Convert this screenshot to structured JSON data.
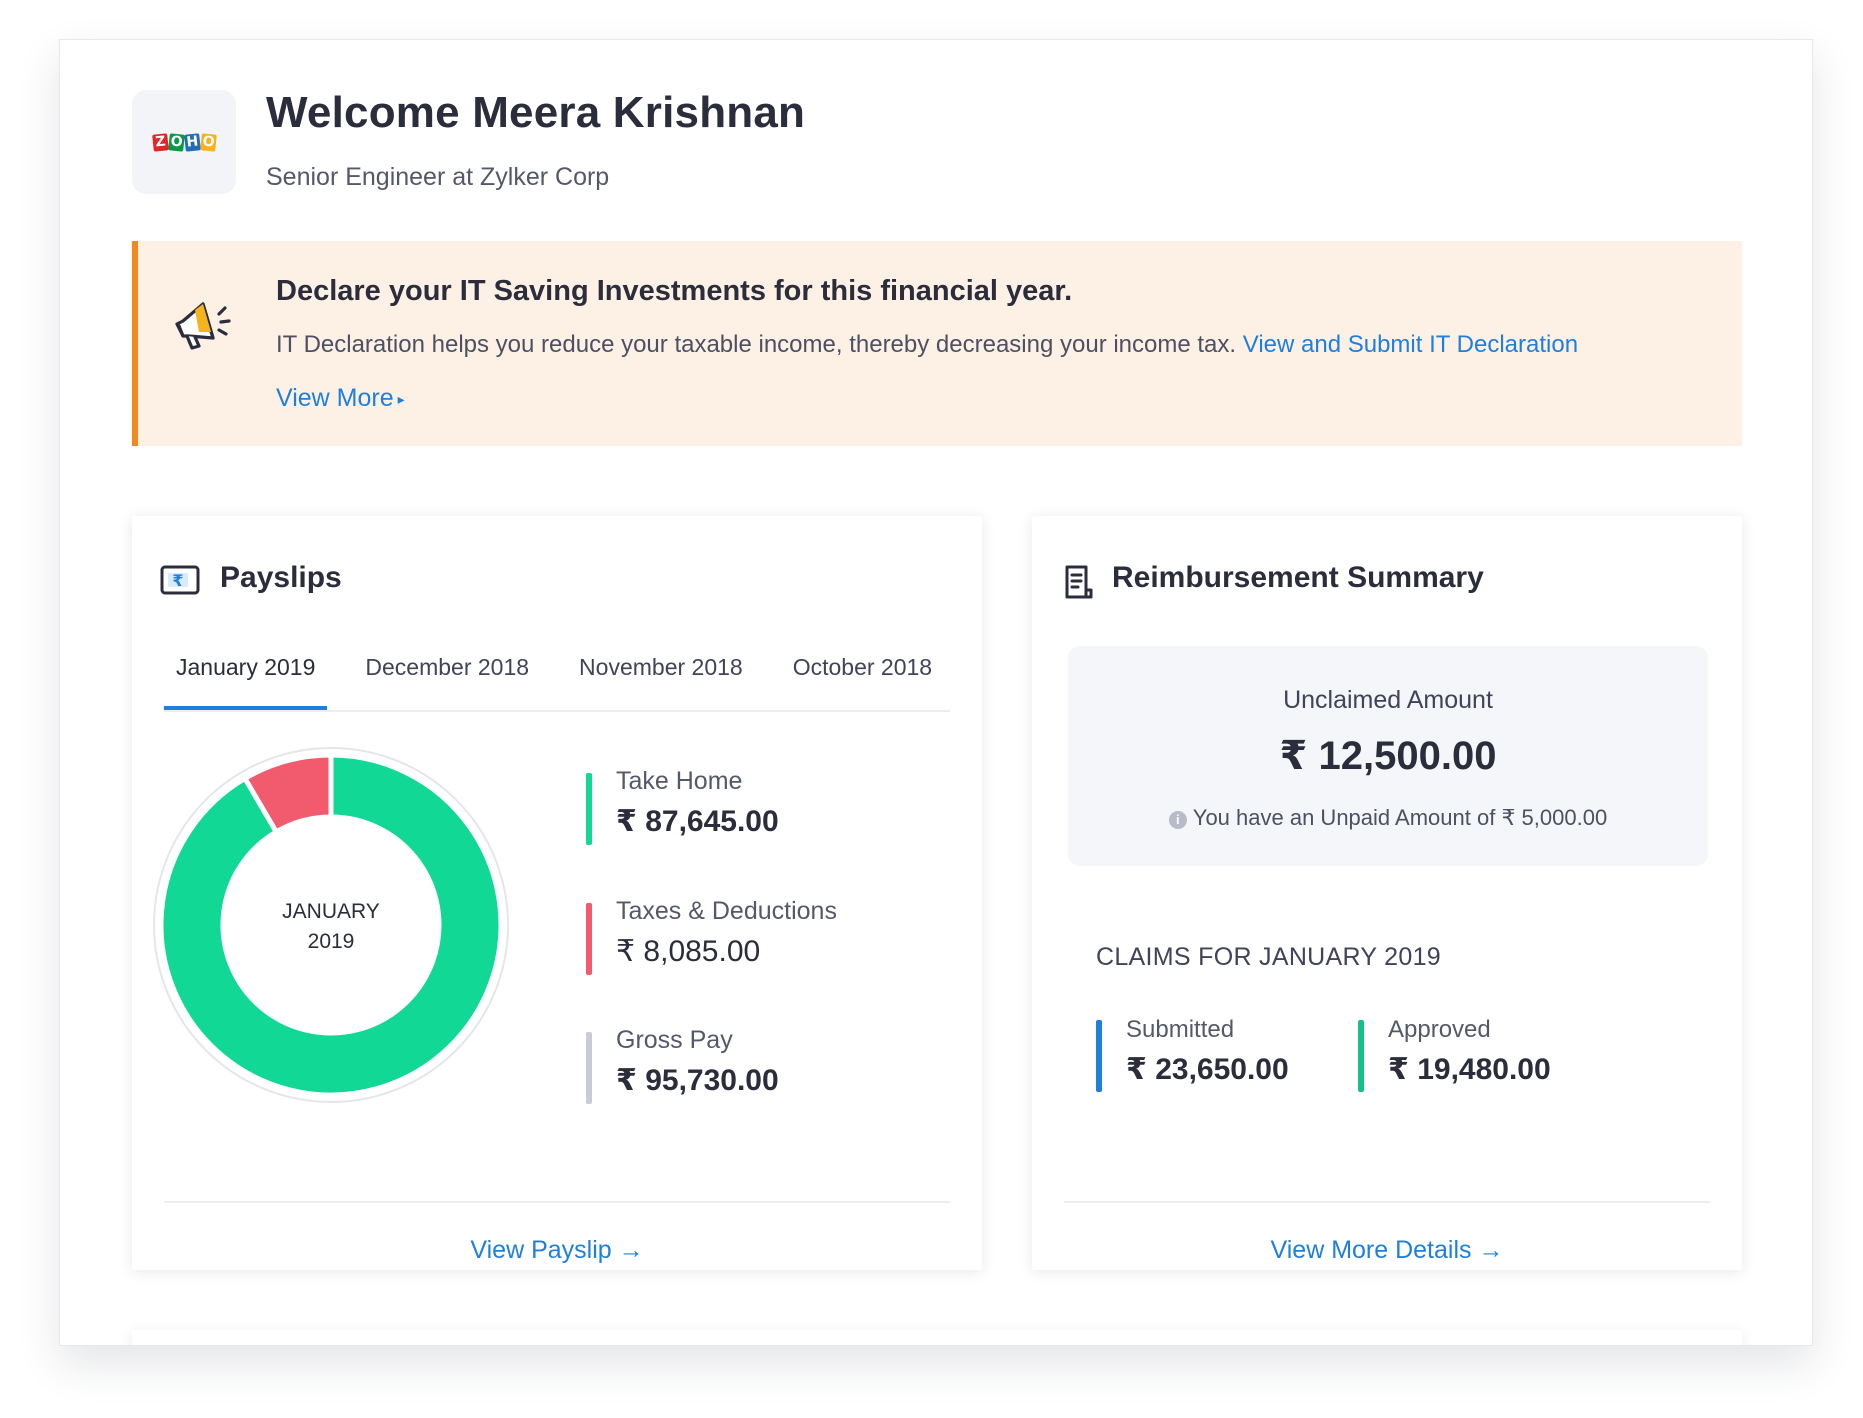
{
  "header": {
    "logo_letters": [
      "Z",
      "O",
      "H",
      "O"
    ],
    "logo_colors": [
      "#e42527",
      "#089949",
      "#226db4",
      "#f9b21d"
    ],
    "welcome": "Welcome Meera Krishnan",
    "subtitle": "Senior Engineer at Zylker Corp"
  },
  "banner": {
    "icon": "megaphone-icon",
    "title": "Declare your IT Saving Investments for this financial year.",
    "text": "IT Declaration helps you reduce your taxable income, thereby decreasing your income tax.",
    "link": "View and Submit IT Declaration",
    "more": "View More",
    "accent": "#f5871f"
  },
  "payslips": {
    "icon": "rupee-note-icon",
    "title": "Payslips",
    "tabs": [
      "January 2019",
      "December 2018",
      "November 2018",
      "October 2018"
    ],
    "active_tab": 0,
    "donut_center": [
      "JANUARY",
      "2019"
    ],
    "take_home": {
      "label": "Take Home",
      "value": "₹ 87,645.00",
      "color": "#12d895"
    },
    "deductions": {
      "label": "Taxes & Deductions",
      "value": "₹ 8,085.00",
      "color": "#f25a6e"
    },
    "gross": {
      "label": "Gross Pay",
      "value": "₹ 95,730.00",
      "color": "#c9ccd6"
    },
    "chart_data": {
      "type": "pie",
      "categories": [
        "Take Home",
        "Taxes & Deductions"
      ],
      "values": [
        87645,
        8085
      ],
      "colors": [
        "#12d895",
        "#f25a6e"
      ]
    },
    "footer_link": "View Payslip →"
  },
  "reimbursement": {
    "icon": "document-icon",
    "title": "Reimbursement Summary",
    "unclaimed_label": "Unclaimed Amount",
    "unclaimed_value": "₹ 12,500.00",
    "unpaid_text": "You have an Unpaid Amount of ₹ 5,000.00",
    "claims_title": "CLAIMS FOR JANUARY 2019",
    "submitted": {
      "label": "Submitted",
      "value": "₹ 23,650.00",
      "color": "#1f7fdd"
    },
    "approved": {
      "label": "Approved",
      "value": "₹ 19,480.00",
      "color": "#12c28a"
    },
    "footer_link": "View More Details →"
  }
}
